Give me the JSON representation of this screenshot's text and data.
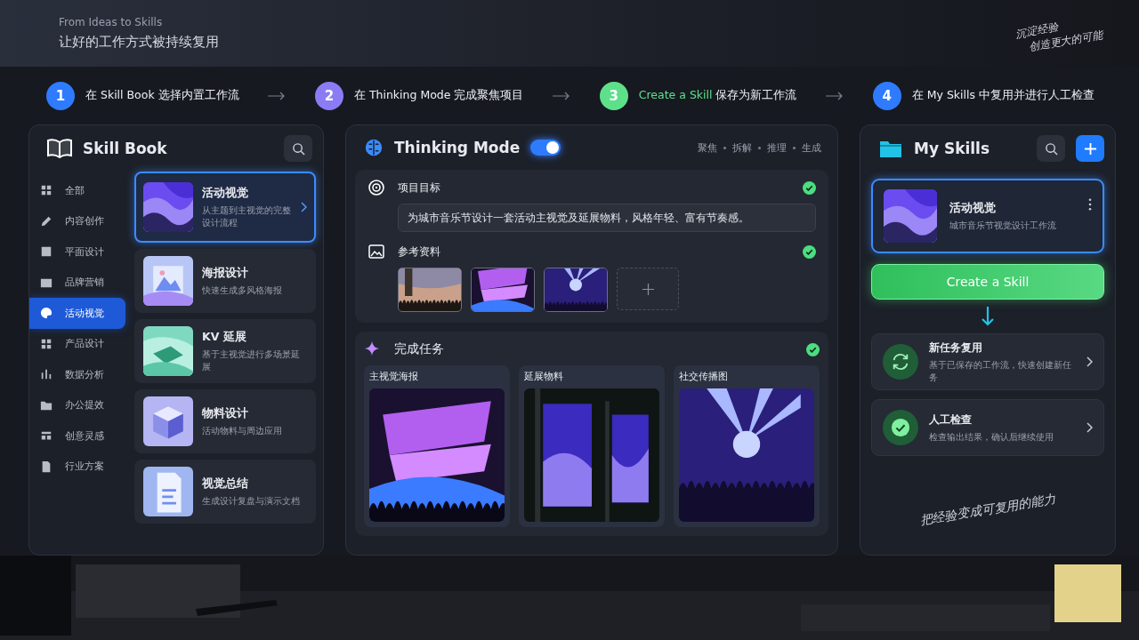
{
  "header": {
    "eyebrow": "From Ideas to Skills",
    "title": "让好的工作方式被持续复用",
    "note_lines": [
      "沉淀经验",
      "创造更大的可能"
    ]
  },
  "steps": [
    {
      "number": "1",
      "text": "在 Skill Book 选择内置工作流",
      "color": "#2f7bff"
    },
    {
      "number": "2",
      "text": "在 Thinking Mode 完成聚焦项目",
      "color": "#8b7cf6"
    },
    {
      "number": "3",
      "lead": "Create a Skill",
      "text": " 保存为新工作流",
      "color": "#5ee08a"
    },
    {
      "number": "4",
      "text": "在 My Skills 中复用并进行人工检查",
      "color": "#2f7bff"
    }
  ],
  "skill_book": {
    "title": "Skill Book",
    "categories": [
      {
        "label": "全部",
        "selected": false
      },
      {
        "label": "内容创作",
        "selected": false
      },
      {
        "label": "平面设计",
        "selected": false
      },
      {
        "label": "品牌营销",
        "selected": false
      },
      {
        "label": "活动视觉",
        "selected": true
      },
      {
        "label": "产品设计",
        "selected": false
      },
      {
        "label": "数据分析",
        "selected": false
      },
      {
        "label": "办公提效",
        "selected": false
      },
      {
        "label": "创意灵感",
        "selected": false
      },
      {
        "label": "行业方案",
        "selected": false
      }
    ],
    "cards": [
      {
        "title": "活动视觉",
        "subtitle": "从主题到主视觉的完整设计流程",
        "selected": true
      },
      {
        "title": "海报设计",
        "subtitle": "快速生成多风格海报",
        "selected": false
      },
      {
        "title": "KV 延展",
        "subtitle": "基于主视觉进行多场景延展",
        "selected": false
      },
      {
        "title": "物料设计",
        "subtitle": "活动物料与周边应用",
        "selected": false
      },
      {
        "title": "视觉总结",
        "subtitle": "生成设计复盘与演示文档",
        "selected": false
      }
    ]
  },
  "thinking": {
    "title": "Thinking Mode",
    "toggle_on": true,
    "stages": [
      "聚焦",
      "拆解",
      "推理",
      "生成"
    ],
    "goal": {
      "label": "项目目标",
      "value": "为城市音乐节设计一套活动主视觉及延展物料，风格年轻、富有节奏感。",
      "done": true
    },
    "references": {
      "label": "参考资料",
      "done": true
    },
    "tasks": {
      "title": "完成任务",
      "done": true,
      "items": [
        {
          "label": "主视觉海报"
        },
        {
          "label": "延展物料"
        },
        {
          "label": "社交传播图"
        }
      ]
    }
  },
  "my_skills": {
    "title": "My Skills",
    "skill": {
      "title": "活动视觉",
      "subtitle": "城市音乐节视觉设计工作流",
      "selected": true
    },
    "create_button": "Create a Skill",
    "actions": [
      {
        "kind": "reuse",
        "title": "新任务复用",
        "subtitle": "基于已保存的工作流，快速创建新任务"
      },
      {
        "kind": "check",
        "title": "人工检查",
        "subtitle": "检查输出结果，确认后继续使用"
      }
    ],
    "note": "把经验变成可复用的能力"
  }
}
